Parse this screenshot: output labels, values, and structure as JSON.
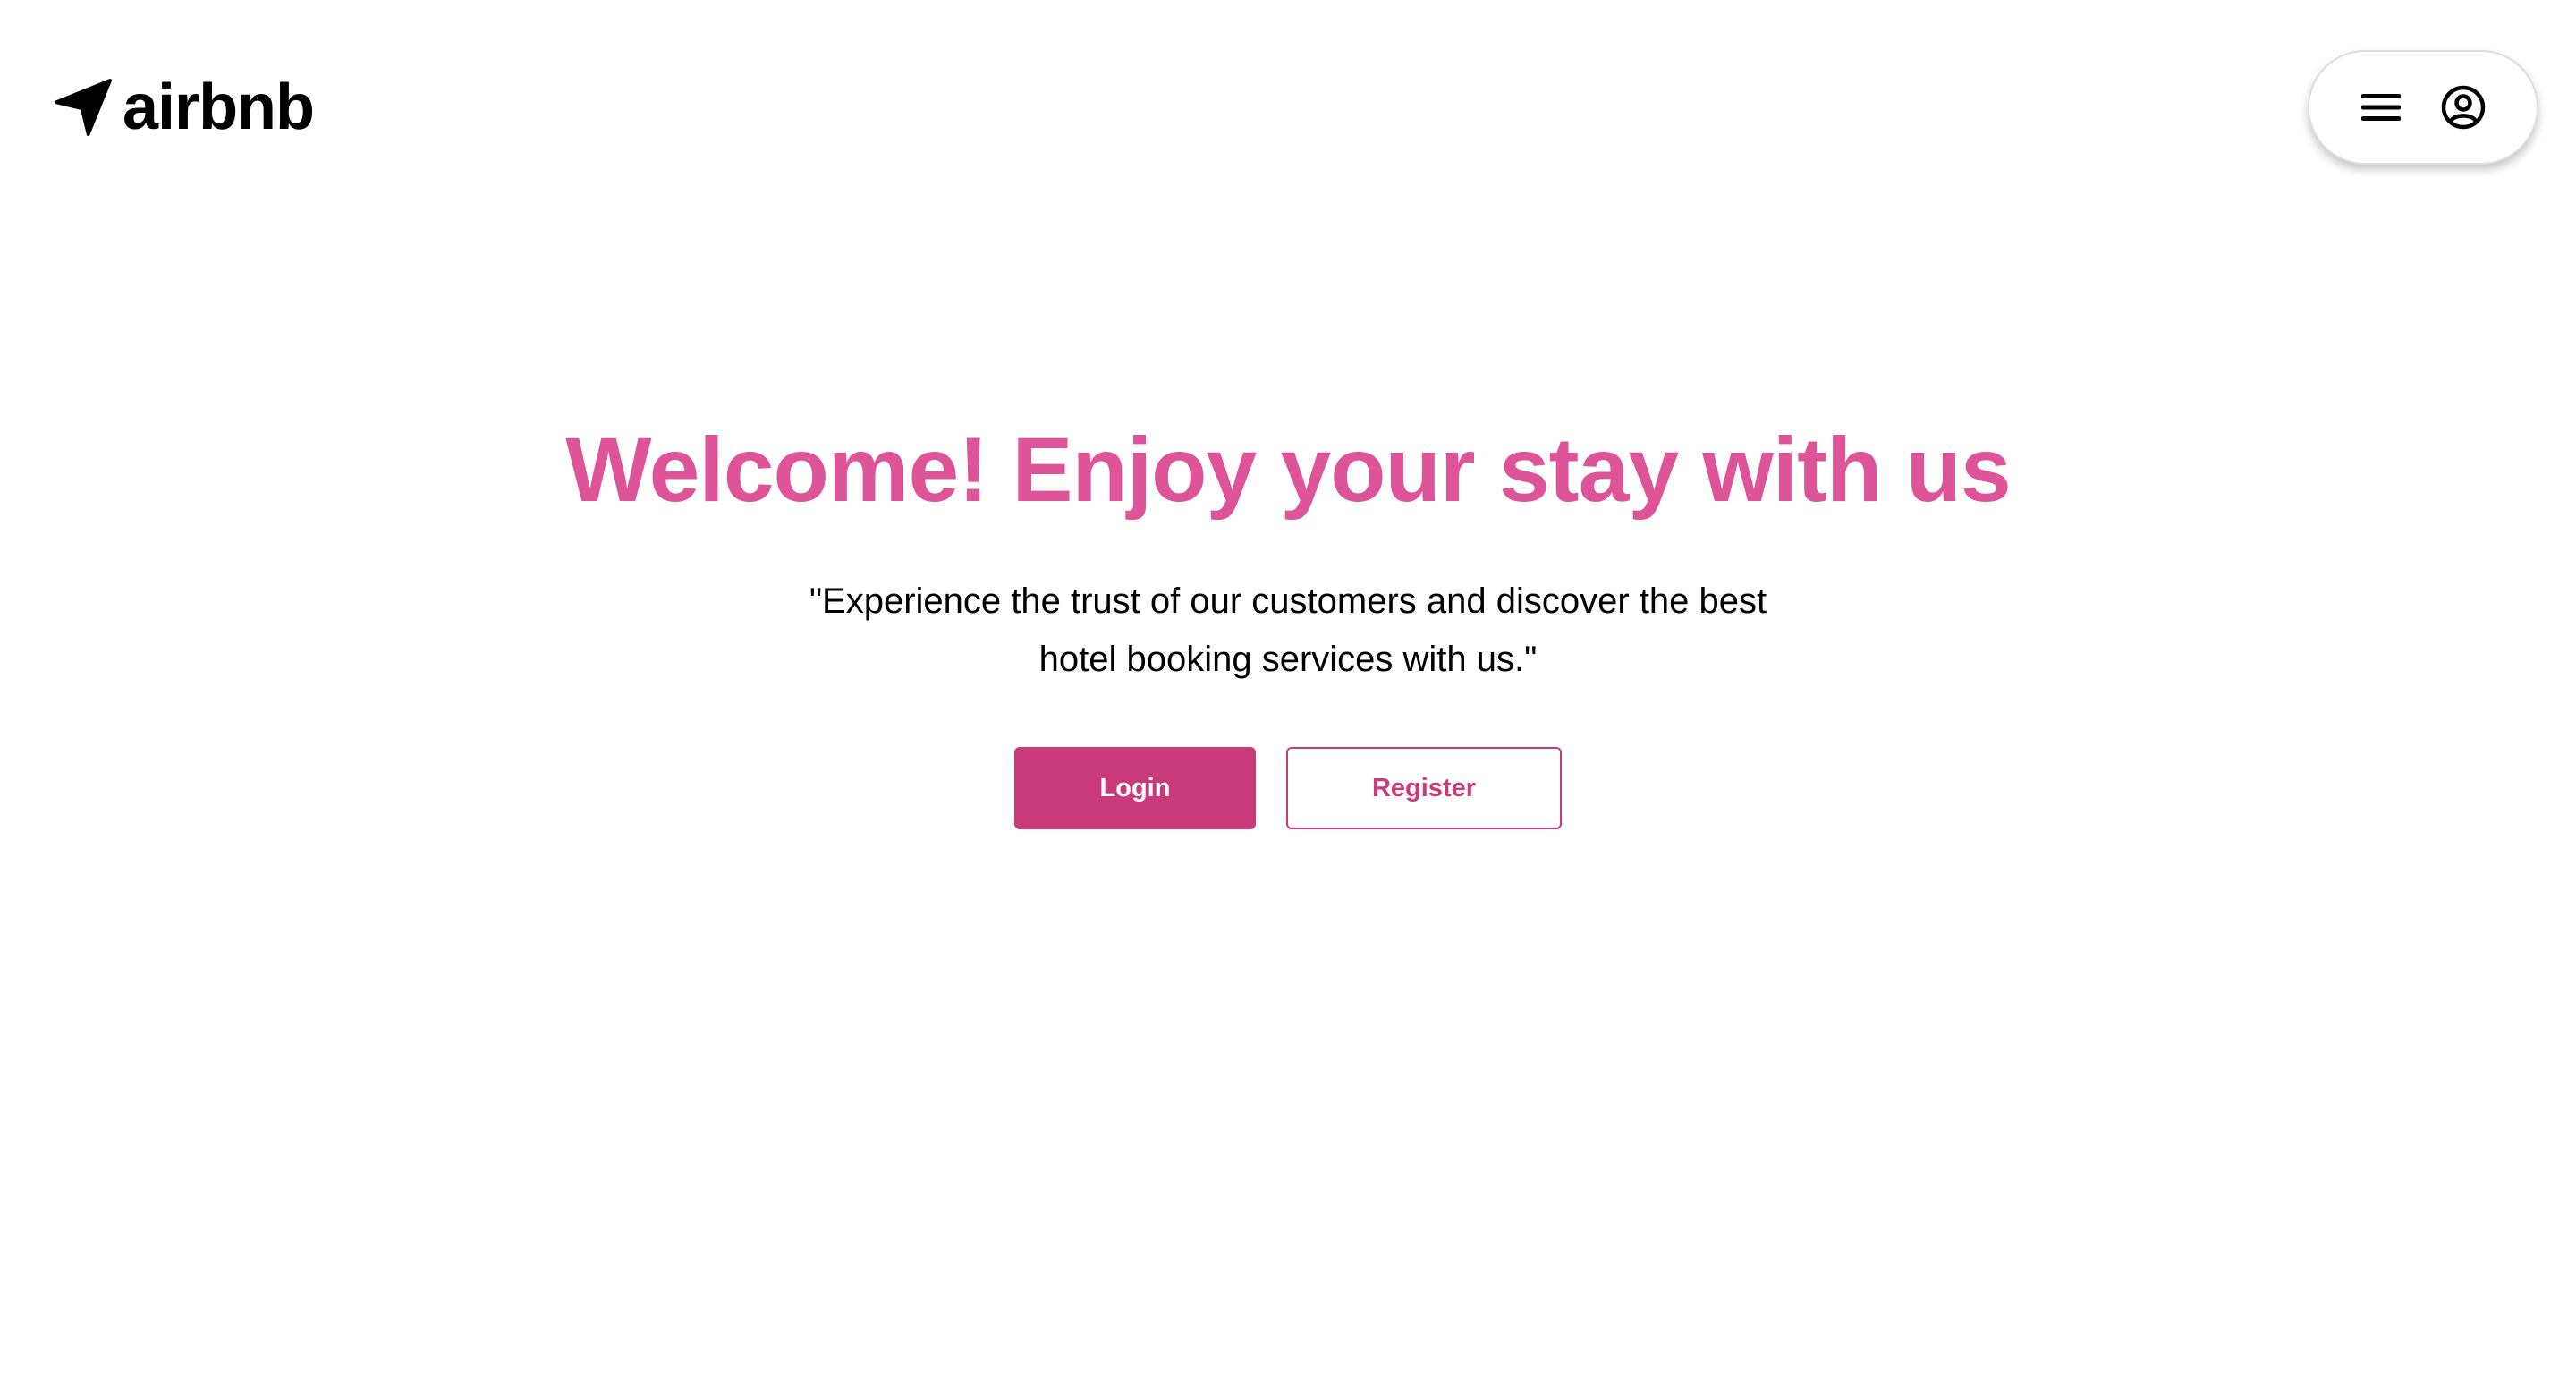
{
  "header": {
    "brand": {
      "text": "airbnb",
      "icon": "navigation-arrow-icon"
    },
    "user_menu": {
      "menu_icon": "hamburger-menu-icon",
      "profile_icon": "user-circle-icon"
    }
  },
  "hero": {
    "title": "Welcome! Enjoy your stay with us",
    "subtitle": "\"Experience the trust of our customers and discover the best hotel booking services with us.\"",
    "login_label": "Login",
    "register_label": "Register"
  },
  "colors": {
    "accent": "#c93a78",
    "title": "#de5499",
    "text": "#000000",
    "background": "#ffffff"
  }
}
